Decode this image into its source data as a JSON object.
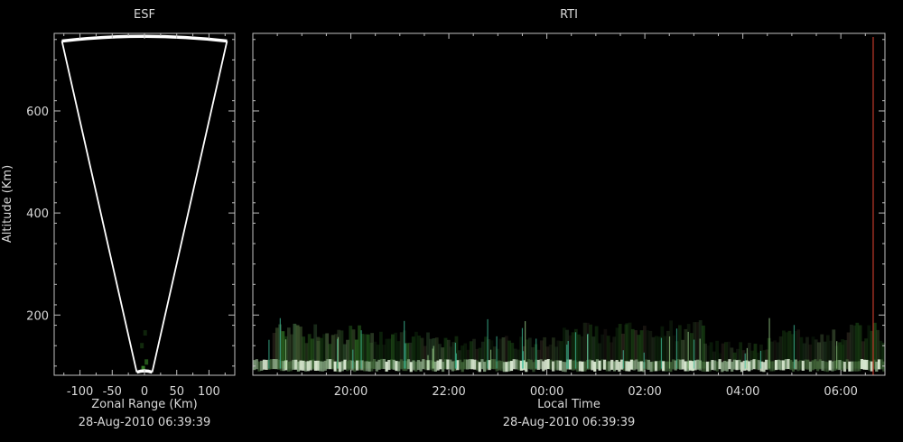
{
  "colors": {
    "background": "#000000",
    "axis": "#bfbfbf",
    "text": "#d8d8d8",
    "fan_outline": "#ffffff",
    "current_time_line": "#c0392b",
    "echo_green": "#3a8a2a",
    "echo_light": "#d8e8d0"
  },
  "chart_data": [
    {
      "id": "esf",
      "type": "heatmap",
      "title": "ESF",
      "xlabel": "Zonal Range (Km)",
      "ylabel": "Altitude (Km)",
      "footer": "28-Aug-2010 06:39:39",
      "xlim": [
        -140,
        140
      ],
      "ylim": [
        82,
        752
      ],
      "xticks": [
        -100,
        -50,
        0,
        50,
        100
      ],
      "xtick_labels": [
        "-100",
        "-50",
        "0",
        "50",
        "100"
      ],
      "yticks": [
        200,
        400,
        600
      ],
      "ytick_labels": [
        "200",
        "400",
        "600"
      ],
      "fan": {
        "apex_altitude": 88,
        "top_altitude": 745,
        "half_angle_deg": 13.5,
        "apex_zonal": 0
      },
      "echoes": [
        {
          "x": -2,
          "y": 95,
          "intensity": 0.9
        },
        {
          "x": 3,
          "y": 108,
          "intensity": 0.6
        },
        {
          "x": -4,
          "y": 140,
          "intensity": 0.3
        },
        {
          "x": 1,
          "y": 165,
          "intensity": 0.25
        }
      ],
      "grid": false
    },
    {
      "id": "rti",
      "type": "heatmap",
      "title": "RTI",
      "xlabel": "Local Time",
      "footer": "28-Aug-2010 06:39:39",
      "x_unit": "hours since 18:00 local time",
      "xlim": [
        18.0,
        30.9
      ],
      "ylim": [
        82,
        752
      ],
      "xticks": [
        20,
        22,
        24,
        26,
        28,
        30
      ],
      "xtick_labels": [
        "20:00",
        "22:00",
        "00:00",
        "02:00",
        "04:00",
        "06:00"
      ],
      "yticks": [
        200,
        400,
        600
      ],
      "current_time": 30.66,
      "grid": false,
      "bands": [
        {
          "t0": 18.4,
          "t1": 19.3,
          "h0": 95,
          "h1": 185,
          "intensity": 0.55
        },
        {
          "t0": 19.3,
          "t1": 20.4,
          "h0": 95,
          "h1": 180,
          "intensity": 0.45
        },
        {
          "t0": 20.4,
          "t1": 22.0,
          "h0": 95,
          "h1": 170,
          "intensity": 0.35
        },
        {
          "t0": 22.0,
          "t1": 24.2,
          "h0": 95,
          "h1": 160,
          "intensity": 0.3
        },
        {
          "t0": 24.2,
          "t1": 25.6,
          "h0": 95,
          "h1": 185,
          "intensity": 0.3
        },
        {
          "t0": 25.6,
          "t1": 27.2,
          "h0": 95,
          "h1": 190,
          "intensity": 0.3
        },
        {
          "t0": 27.2,
          "t1": 28.5,
          "h0": 95,
          "h1": 150,
          "intensity": 0.25
        },
        {
          "t0": 28.5,
          "t1": 30.0,
          "h0": 95,
          "h1": 175,
          "intensity": 0.3
        },
        {
          "t0": 30.0,
          "t1": 30.9,
          "h0": 95,
          "h1": 185,
          "intensity": 0.35
        }
      ],
      "bottom_layer": {
        "h0": 92,
        "h1": 108
      }
    }
  ]
}
